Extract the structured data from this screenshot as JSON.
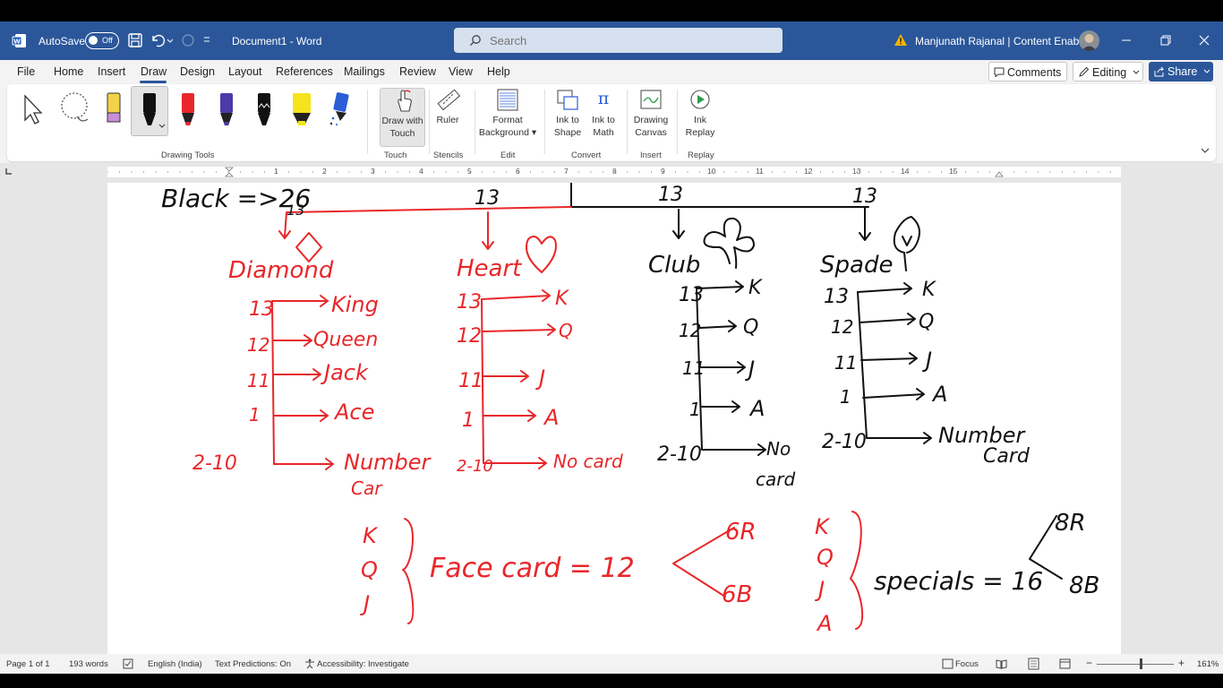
{
  "titlebar": {
    "autosave_label": "AutoSave",
    "autosave_state": "Off",
    "doc_title": "Document1 - Word",
    "search_placeholder": "Search",
    "account_name": "Manjunath Rajanal | Content Enablers"
  },
  "menu": {
    "tabs": [
      "File",
      "Home",
      "Insert",
      "Draw",
      "Design",
      "Layout",
      "References",
      "Mailings",
      "Review",
      "View",
      "Help"
    ],
    "active_tab": "Draw",
    "comments_label": "Comments",
    "editing_label": "Editing",
    "share_label": "Share"
  },
  "ribbon": {
    "groups": {
      "drawing_tools": "Drawing Tools",
      "touch": "Touch",
      "stencils": "Stencils",
      "edit": "Edit",
      "convert": "Convert",
      "insert": "Insert",
      "replay": "Replay"
    },
    "buttons": {
      "draw_with_touch": [
        "Draw with",
        "Touch"
      ],
      "ruler": "Ruler",
      "format_background": [
        "Format",
        "Background"
      ],
      "ink_to_shape": [
        "Ink to",
        "Shape"
      ],
      "ink_to_math": [
        "Ink to",
        "Math"
      ],
      "drawing_canvas": [
        "Drawing",
        "Canvas"
      ],
      "ink_replay": [
        "Ink",
        "Replay"
      ]
    },
    "pen_colors": [
      "#f2d24a",
      "#111111",
      "#e8272a",
      "#4b3aa8",
      "#111111",
      "#f5e31c",
      "#2a5dd6"
    ]
  },
  "ruler": {
    "numbers": [
      "1",
      "1",
      "2",
      "3",
      "4",
      "5",
      "6",
      "7",
      "8",
      "9",
      "10",
      "11",
      "12",
      "13",
      "14",
      "15"
    ]
  },
  "ink": {
    "header_black": "Black =>26",
    "header_13": [
      "13",
      "13",
      "13",
      "13"
    ],
    "suits": [
      "Diamond",
      "Heart",
      "Club",
      "Spade"
    ],
    "diamond_rows": [
      [
        "13",
        "King"
      ],
      [
        "12",
        "Queen"
      ],
      [
        "11",
        "Jack"
      ],
      [
        "1",
        "Ace"
      ],
      [
        "2-10",
        "Number"
      ]
    ],
    "diamond_tail": "Car",
    "heart_rows": [
      [
        "13",
        "K"
      ],
      [
        "12",
        "Q"
      ],
      [
        "11",
        "J"
      ],
      [
        "1",
        "A"
      ],
      [
        "2-10",
        "No card"
      ]
    ],
    "club_rows": [
      [
        "13",
        "K"
      ],
      [
        "12",
        "Q"
      ],
      [
        "11",
        "J"
      ],
      [
        "1",
        "A"
      ],
      [
        "2-10",
        "No"
      ]
    ],
    "club_tail": "card",
    "spade_rows": [
      [
        "13",
        "K"
      ],
      [
        "12",
        "Q"
      ],
      [
        "11",
        "J"
      ],
      [
        "1",
        "A"
      ],
      [
        "2-10",
        "Number"
      ]
    ],
    "spade_tail": "Card",
    "face_letters": [
      "K",
      "Q",
      "J"
    ],
    "face_text": "Face card = 12",
    "face_split": [
      "6R",
      "6B"
    ],
    "special_letters": [
      "K",
      "Q",
      "J",
      "A"
    ],
    "special_text": "specials = 16",
    "special_split": [
      "8R",
      "8B"
    ],
    "colors": {
      "red": "#e8272a",
      "black": "#111111"
    }
  },
  "status": {
    "page": "Page 1 of 1",
    "words": "193 words",
    "language": "English (India)",
    "predictions": "Text Predictions: On",
    "accessibility": "Accessibility: Investigate",
    "focus": "Focus",
    "zoom": "161%"
  }
}
